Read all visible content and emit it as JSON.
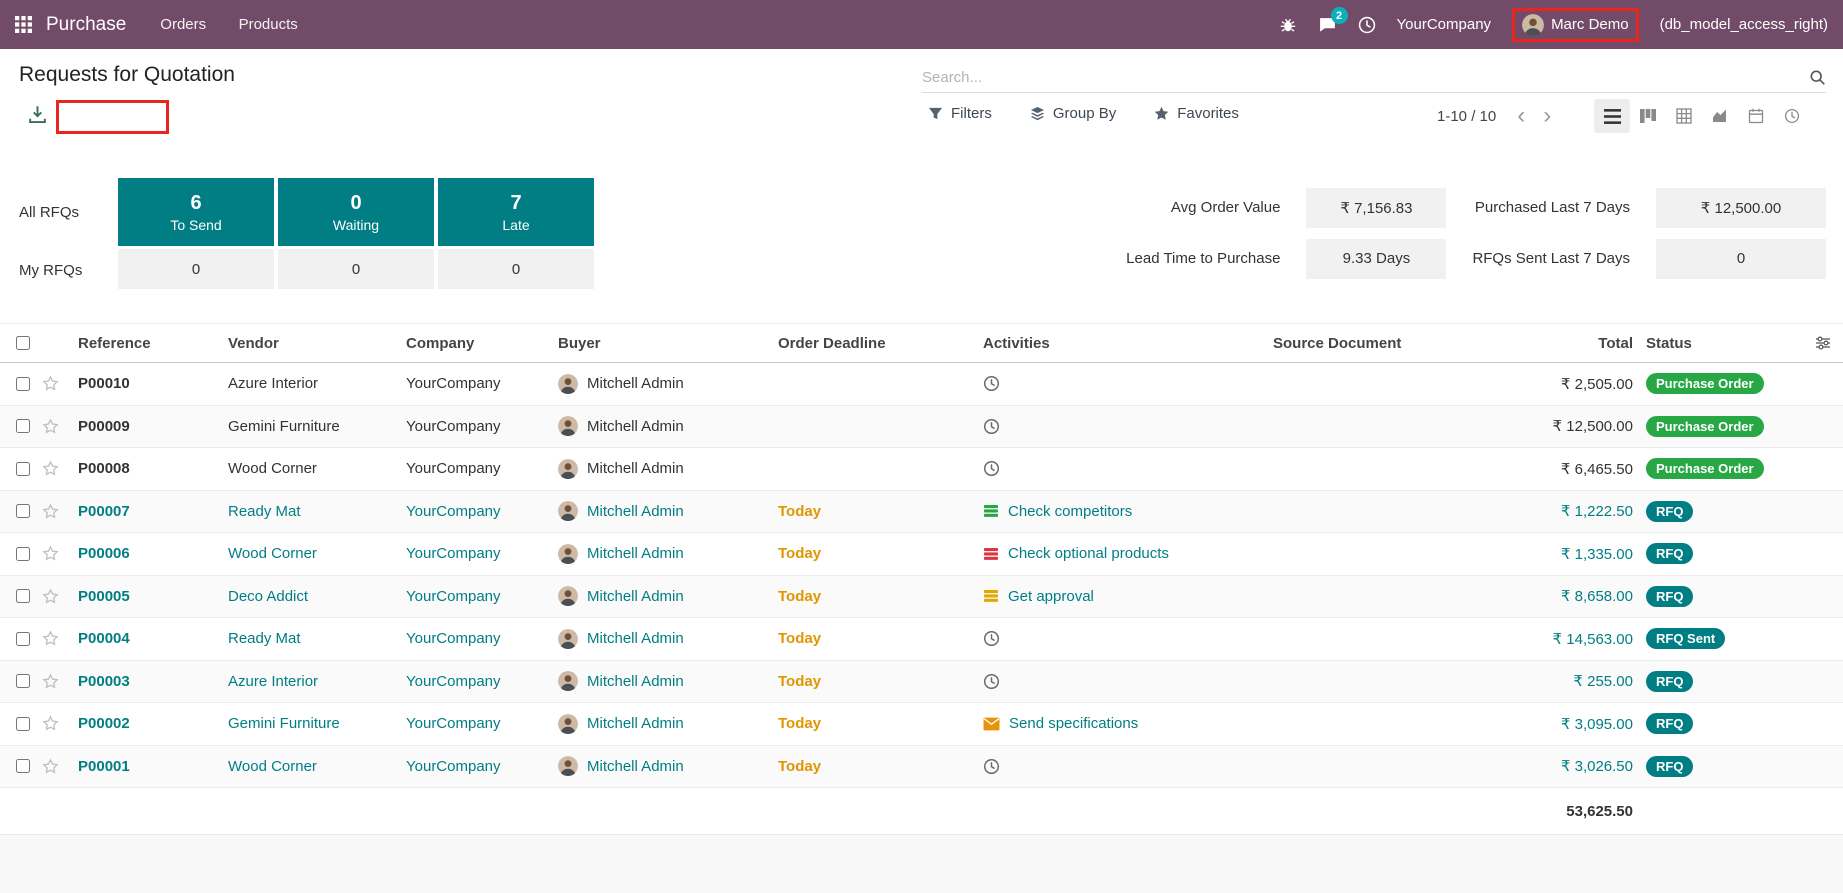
{
  "colors": {
    "navbar_bg": "#714B67",
    "accent_teal": "#017e84",
    "badge_green": "#28a745",
    "deadline_warning": "#e09600",
    "annotation_red": "#e8261f",
    "message_badge": "#0cb0bd"
  },
  "icons": {
    "navbar": [
      "apps-grid-icon",
      "bug-icon",
      "messages-icon",
      "activity-clock-icon",
      "user-avatar"
    ],
    "control": [
      "download-icon",
      "filter-funnel-icon",
      "group-by-layers-icon",
      "favorites-star-icon",
      "search-icon",
      "prev-page-chevron",
      "next-page-chevron"
    ],
    "views": [
      "view-list-icon",
      "view-kanban-icon",
      "view-pivot-icon",
      "view-graph-icon",
      "view-calendar-icon",
      "view-activity-icon"
    ],
    "table": [
      "select-all-checkbox",
      "favorite-star-icon",
      "buyer-avatar",
      "clock-icon",
      "list-icon",
      "envelope-icon",
      "optional-columns-icon"
    ]
  },
  "navbar": {
    "app_name": "Purchase",
    "menus": [
      {
        "label": "Orders"
      },
      {
        "label": "Products"
      }
    ],
    "message_count": "2",
    "company": "YourCompany",
    "user_name": "Marc Demo",
    "user_suffix": "(db_model_access_right)"
  },
  "control_panel": {
    "title": "Requests for Quotation",
    "search_placeholder": "Search...",
    "filters_label": "Filters",
    "group_by_label": "Group By",
    "favorites_label": "Favorites",
    "pager": "1-10 / 10"
  },
  "dashboard": {
    "row1_label": "All RFQs",
    "row2_label": "My RFQs",
    "cards": [
      {
        "count": "6",
        "label": "To Send",
        "my_count": "0"
      },
      {
        "count": "0",
        "label": "Waiting",
        "my_count": "0"
      },
      {
        "count": "7",
        "label": "Late",
        "my_count": "0"
      }
    ],
    "stats": [
      {
        "label": "Avg Order Value",
        "value": "₹ 7,156.83"
      },
      {
        "label": "Purchased Last 7 Days",
        "value": "₹ 12,500.00"
      },
      {
        "label": "Lead Time to Purchase",
        "value": "9.33 Days"
      },
      {
        "label": "RFQs Sent Last 7 Days",
        "value": "0"
      }
    ]
  },
  "table": {
    "headers": {
      "reference": "Reference",
      "vendor": "Vendor",
      "company": "Company",
      "buyer": "Buyer",
      "deadline": "Order Deadline",
      "activities": "Activities",
      "source": "Source Document",
      "total": "Total",
      "status": "Status"
    },
    "rows": [
      {
        "reference": "P00010",
        "vendor": "Azure Interior",
        "company": "YourCompany",
        "buyer": "Mitchell Admin",
        "deadline": "",
        "activity": {
          "icon": "clock",
          "color": "#6b6b6b",
          "text": ""
        },
        "source": "",
        "total": "₹ 2,505.00",
        "status": "Purchase Order",
        "status_variant": "green",
        "highlight": false
      },
      {
        "reference": "P00009",
        "vendor": "Gemini Furniture",
        "company": "YourCompany",
        "buyer": "Mitchell Admin",
        "deadline": "",
        "activity": {
          "icon": "clock",
          "color": "#6b6b6b",
          "text": ""
        },
        "source": "",
        "total": "₹ 12,500.00",
        "status": "Purchase Order",
        "status_variant": "green",
        "highlight": false
      },
      {
        "reference": "P00008",
        "vendor": "Wood Corner",
        "company": "YourCompany",
        "buyer": "Mitchell Admin",
        "deadline": "",
        "activity": {
          "icon": "clock",
          "color": "#6b6b6b",
          "text": ""
        },
        "source": "",
        "total": "₹ 6,465.50",
        "status": "Purchase Order",
        "status_variant": "green",
        "highlight": false
      },
      {
        "reference": "P00007",
        "vendor": "Ready Mat",
        "company": "YourCompany",
        "buyer": "Mitchell Admin",
        "deadline": "Today",
        "activity": {
          "icon": "list",
          "color": "#28a745",
          "text": "Check competitors"
        },
        "source": "",
        "total": "₹ 1,222.50",
        "status": "RFQ",
        "status_variant": "teal",
        "highlight": true
      },
      {
        "reference": "P00006",
        "vendor": "Wood Corner",
        "company": "YourCompany",
        "buyer": "Mitchell Admin",
        "deadline": "Today",
        "activity": {
          "icon": "list",
          "color": "#dc3545",
          "text": "Check optional products"
        },
        "source": "",
        "total": "₹ 1,335.00",
        "status": "RFQ",
        "status_variant": "teal",
        "highlight": true
      },
      {
        "reference": "P00005",
        "vendor": "Deco Addict",
        "company": "YourCompany",
        "buyer": "Mitchell Admin",
        "deadline": "Today",
        "activity": {
          "icon": "list",
          "color": "#e0a800",
          "text": "Get approval"
        },
        "source": "",
        "total": "₹ 8,658.00",
        "status": "RFQ",
        "status_variant": "teal",
        "highlight": true
      },
      {
        "reference": "P00004",
        "vendor": "Ready Mat",
        "company": "YourCompany",
        "buyer": "Mitchell Admin",
        "deadline": "Today",
        "activity": {
          "icon": "clock",
          "color": "#6b6b6b",
          "text": ""
        },
        "source": "",
        "total": "₹ 14,563.00",
        "status": "RFQ Sent",
        "status_variant": "teal",
        "highlight": true
      },
      {
        "reference": "P00003",
        "vendor": "Azure Interior",
        "company": "YourCompany",
        "buyer": "Mitchell Admin",
        "deadline": "Today",
        "activity": {
          "icon": "clock",
          "color": "#6b6b6b",
          "text": ""
        },
        "source": "",
        "total": "₹ 255.00",
        "status": "RFQ",
        "status_variant": "teal",
        "highlight": true
      },
      {
        "reference": "P00002",
        "vendor": "Gemini Furniture",
        "company": "YourCompany",
        "buyer": "Mitchell Admin",
        "deadline": "Today",
        "activity": {
          "icon": "envelope",
          "color": "#e8930c",
          "text": "Send specifications"
        },
        "source": "",
        "total": "₹ 3,095.00",
        "status": "RFQ",
        "status_variant": "teal",
        "highlight": true
      },
      {
        "reference": "P00001",
        "vendor": "Wood Corner",
        "company": "YourCompany",
        "buyer": "Mitchell Admin",
        "deadline": "Today",
        "activity": {
          "icon": "clock",
          "color": "#6b6b6b",
          "text": ""
        },
        "source": "",
        "total": "₹ 3,026.50",
        "status": "RFQ",
        "status_variant": "teal",
        "highlight": true
      }
    ],
    "footer_total": "53,625.50"
  }
}
